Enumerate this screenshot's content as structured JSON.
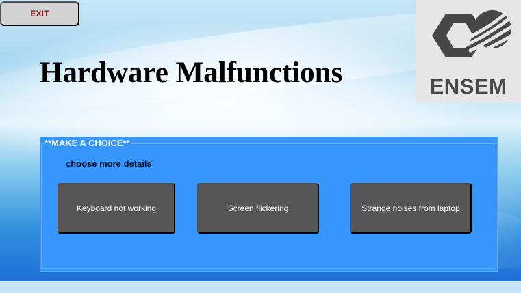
{
  "app": {
    "title": "Hardware Malfunctions"
  },
  "toolbar": {
    "exit_label": "EXIT"
  },
  "logo": {
    "text": "ENSEM"
  },
  "panel": {
    "title": "**MAKE A CHOICE**",
    "subtitle": "choose more details"
  },
  "choices": [
    {
      "label": "Keyboard not working"
    },
    {
      "label": "Screen flickering"
    },
    {
      "label": "Strange noises from laptop"
    }
  ],
  "colors": {
    "panel_blue": "#3796fb",
    "button_gray": "#565656",
    "exit_button_bg": "#d3d3d3",
    "exit_text": "#8b1a1a"
  },
  "icons": {
    "logo_mark": "ensem-logo-icon"
  }
}
